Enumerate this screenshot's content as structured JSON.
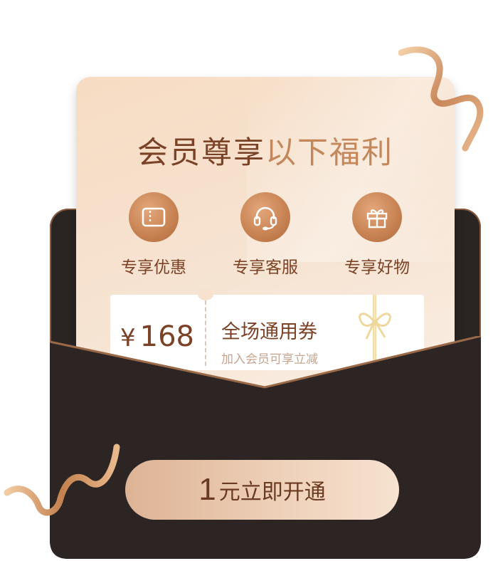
{
  "title": {
    "part1": "会员尊享",
    "part2": "以下福利"
  },
  "benefits": [
    {
      "label": "专享优惠",
      "icon": "ticket-icon"
    },
    {
      "label": "专享客服",
      "icon": "headset-icon"
    },
    {
      "label": "专享好物",
      "icon": "gift-icon"
    }
  ],
  "coupon": {
    "currency": "¥",
    "amount": "168",
    "name": "全场通用券",
    "description": "加入会员可享立减"
  },
  "cta": {
    "number": "1",
    "text": "元立即开通"
  },
  "colors": {
    "brand_brown": "#7a4226",
    "accent": "#c4875c",
    "envelope": "#2a2423"
  }
}
